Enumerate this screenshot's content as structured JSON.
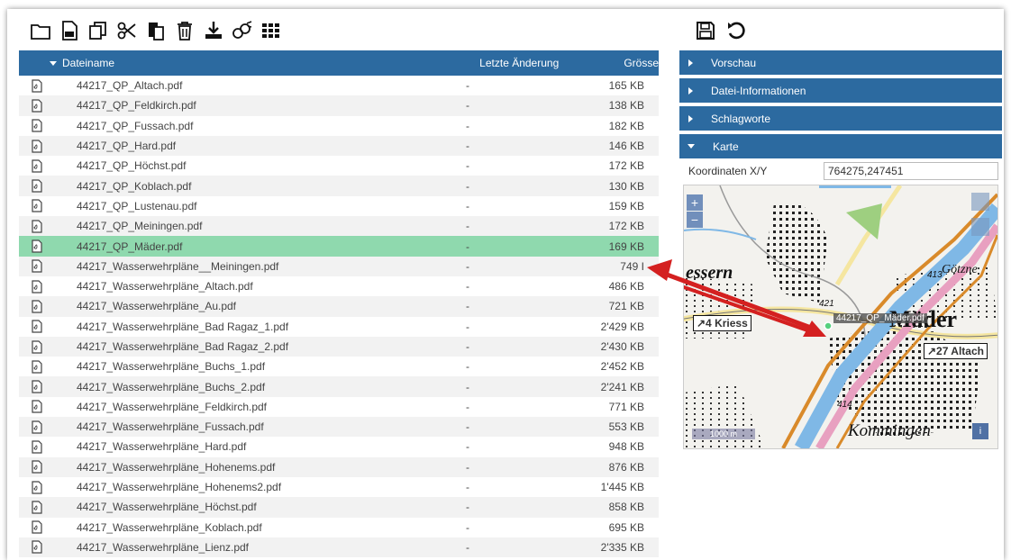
{
  "toolbar": {
    "icons": [
      "new-folder-icon",
      "save-file-icon",
      "copy-icon",
      "cut-icon",
      "paste-icon",
      "delete-icon",
      "download-icon",
      "share-icon",
      "grid-view-icon"
    ],
    "right_icons": [
      "save-icon",
      "undo-icon"
    ]
  },
  "filelist": {
    "header": {
      "name": "Dateiname",
      "date": "Letzte Änderung",
      "size": "Grösse"
    },
    "rows": [
      {
        "name": "44217_QP_Altach.pdf",
        "date": "-",
        "size": "165 KB"
      },
      {
        "name": "44217_QP_Feldkirch.pdf",
        "date": "-",
        "size": "138 KB"
      },
      {
        "name": "44217_QP_Fussach.pdf",
        "date": "-",
        "size": "182 KB"
      },
      {
        "name": "44217_QP_Hard.pdf",
        "date": "-",
        "size": "146 KB"
      },
      {
        "name": "44217_QP_Höchst.pdf",
        "date": "-",
        "size": "172 KB"
      },
      {
        "name": "44217_QP_Koblach.pdf",
        "date": "-",
        "size": "130 KB"
      },
      {
        "name": "44217_QP_Lustenau.pdf",
        "date": "-",
        "size": "159 KB"
      },
      {
        "name": "44217_QP_Meiningen.pdf",
        "date": "-",
        "size": "172 KB"
      },
      {
        "name": "44217_QP_Mäder.pdf",
        "date": "-",
        "size": "169 KB",
        "selected": true
      },
      {
        "name": "44217_Wasserwehrpläne__Meiningen.pdf",
        "date": "-",
        "size": "749 I"
      },
      {
        "name": "44217_Wasserwehrpläne_Altach.pdf",
        "date": "-",
        "size": "486 KB"
      },
      {
        "name": "44217_Wasserwehrpläne_Au.pdf",
        "date": "-",
        "size": "721 KB"
      },
      {
        "name": "44217_Wasserwehrpläne_Bad Ragaz_1.pdf",
        "date": "-",
        "size": "2'429 KB"
      },
      {
        "name": "44217_Wasserwehrpläne_Bad Ragaz_2.pdf",
        "date": "-",
        "size": "2'430 KB"
      },
      {
        "name": "44217_Wasserwehrpläne_Buchs_1.pdf",
        "date": "-",
        "size": "2'452 KB"
      },
      {
        "name": "44217_Wasserwehrpläne_Buchs_2.pdf",
        "date": "-",
        "size": "2'241 KB"
      },
      {
        "name": "44217_Wasserwehrpläne_Feldkirch.pdf",
        "date": "-",
        "size": "771 KB"
      },
      {
        "name": "44217_Wasserwehrpläne_Fussach.pdf",
        "date": "-",
        "size": "553 KB"
      },
      {
        "name": "44217_Wasserwehrpläne_Hard.pdf",
        "date": "-",
        "size": "948 KB"
      },
      {
        "name": "44217_Wasserwehrpläne_Hohenems.pdf",
        "date": "-",
        "size": "876 KB"
      },
      {
        "name": "44217_Wasserwehrpläne_Hohenems2.pdf",
        "date": "-",
        "size": "1'445 KB"
      },
      {
        "name": "44217_Wasserwehrpläne_Höchst.pdf",
        "date": "-",
        "size": "858 KB"
      },
      {
        "name": "44217_Wasserwehrpläne_Koblach.pdf",
        "date": "-",
        "size": "695 KB"
      },
      {
        "name": "44217_Wasserwehrpläne_Lienz.pdf",
        "date": "-",
        "size": "2'335 KB"
      }
    ]
  },
  "panels": {
    "preview": "Vorschau",
    "fileinfo": "Datei-Informationen",
    "tags": "Schlagworte",
    "map": "Karte"
  },
  "map": {
    "coord_label": "Koordinaten X/Y",
    "coord_value": "764275,247451",
    "place_kriessern": "essern",
    "place_goetzner": "Götzne",
    "place_maeder": "Mäder",
    "place_kommingen": "Kommingen",
    "sign_kriessern": "↗4 Kriess",
    "sign_altach": "↗27 Altach",
    "marker_label": "44217_QP_Mäder.pdf",
    "scale": "1000 m",
    "num_421": "421",
    "num_413": "413",
    "num_414": "414",
    "zoom_in": "+",
    "zoom_out": "−",
    "info": "i"
  },
  "colors": {
    "header_blue": "#2c6aa0",
    "selected_row": "#8fd9ae",
    "arrow_red": "#d42020",
    "river_blue": "#7fb8e6",
    "road_pink": "#e8a0c0",
    "road_orange": "#d98a2a"
  }
}
